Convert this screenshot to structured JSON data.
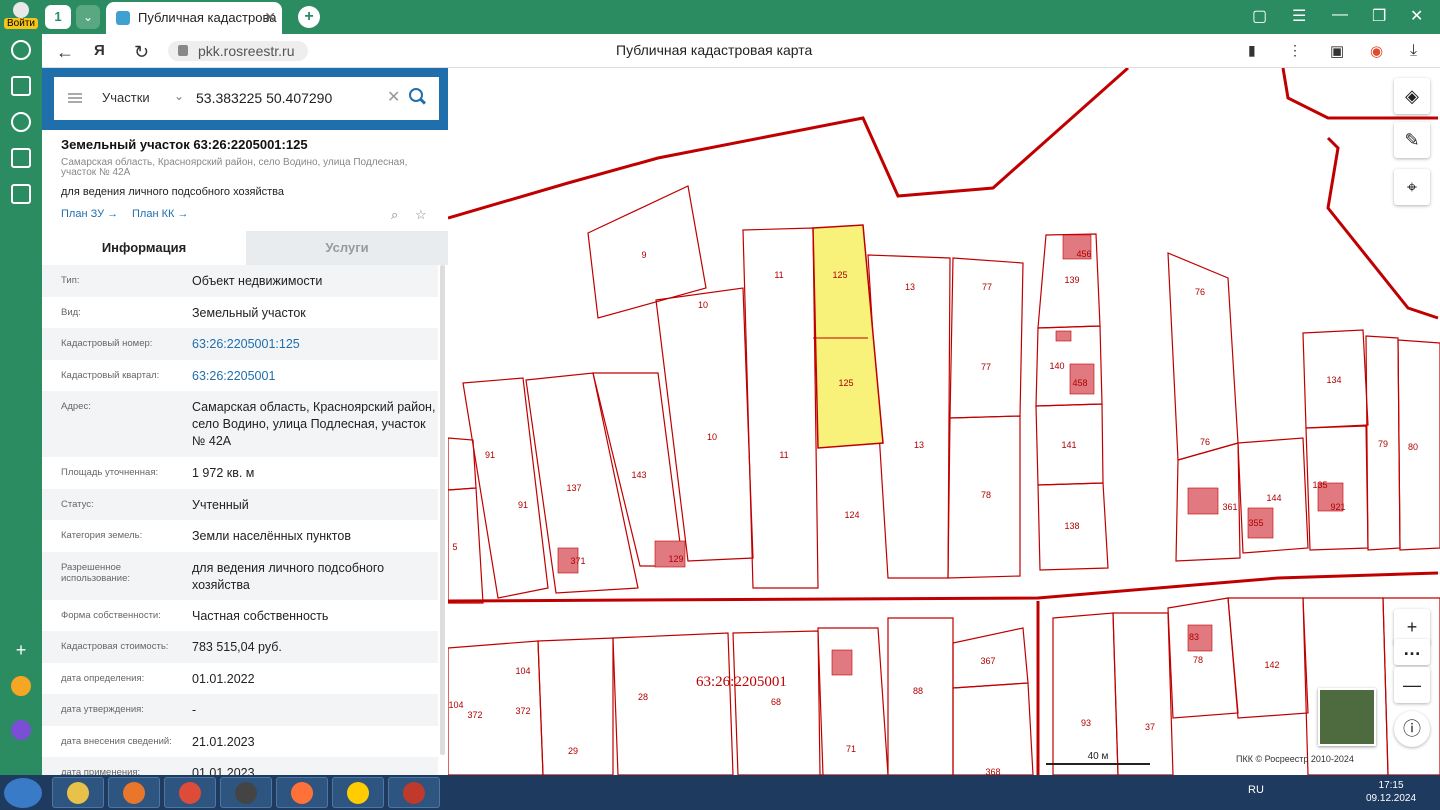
{
  "browser": {
    "login_label": "Войти",
    "tab_count": "1",
    "tab_title": "Публичная кадастрова",
    "url": "pkk.rosreestr.ru",
    "page_title": "Публичная кадастровая карта"
  },
  "search": {
    "type": "Участки",
    "value": "53.383225 50.407290"
  },
  "object": {
    "title": "Земельный участок 63:26:2205001:125",
    "address": "Самарская область, Красноярский район, село Водино, улица Подлесная, участок № 42А",
    "purpose": "для ведения личного подсобного хозяйства",
    "plan_zu": "План ЗУ →",
    "plan_kk": "План КК →"
  },
  "tabs": {
    "info": "Информация",
    "services": "Услуги"
  },
  "rows": [
    {
      "k": "Тип:",
      "v": "Объект недвижимости"
    },
    {
      "k": "Вид:",
      "v": "Земельный участок"
    },
    {
      "k": "Кадастровый номер:",
      "v": "63:26:2205001:125"
    },
    {
      "k": "Кадастровый квартал:",
      "v": "63:26:2205001"
    },
    {
      "k": "Адрес:",
      "v": "Самарская область, Красноярский район, село Водино, улица Подлесная, участок № 42А"
    },
    {
      "k": "Площадь уточненная:",
      "v": "1 972 кв. м"
    },
    {
      "k": "Статус:",
      "v": "Учтенный"
    },
    {
      "k": "Категория земель:",
      "v": "Земли населённых пунктов"
    },
    {
      "k": "Разрешенное использование:",
      "v": "для ведения личного подсобного хозяйства"
    },
    {
      "k": "Форма собственности:",
      "v": "Частная собственность"
    },
    {
      "k": "Кадастровая стоимость:",
      "v": "783 515,04 руб."
    },
    {
      "k": "дата определения:",
      "v": "01.01.2022"
    },
    {
      "k": "дата утверждения:",
      "v": "-"
    },
    {
      "k": "дата внесения сведений:",
      "v": "21.01.2023"
    },
    {
      "k": "дата применения:",
      "v": "01.01.2023"
    }
  ],
  "map": {
    "quarter_label": "63:26:2205001",
    "scale": "40 м",
    "copyright": "ПКК © Росреестр 2010-2024",
    "parcel_labels": [
      "9",
      "10",
      "11",
      "125",
      "125",
      "13",
      "77",
      "77",
      "139",
      "456",
      "140",
      "458",
      "141",
      "138",
      "76",
      "76",
      "134",
      "79",
      "80",
      "135",
      "921",
      "144",
      "355",
      "361",
      "91",
      "91",
      "137",
      "143",
      "129",
      "371",
      "10",
      "11",
      "124",
      "13",
      "78",
      "5",
      "104",
      "372",
      "104",
      "372",
      "29",
      "28",
      "68",
      "71",
      "88",
      "367",
      "368",
      "93",
      "37",
      "78",
      "83",
      "142"
    ]
  },
  "taskbar": {
    "lang": "RU",
    "time": "17:15",
    "date": "09.12.2024"
  },
  "colors": {
    "accent": "#1f6fad",
    "browser": "#2b8c62",
    "parcel": "#c00000",
    "selected": "#f8f27a"
  }
}
